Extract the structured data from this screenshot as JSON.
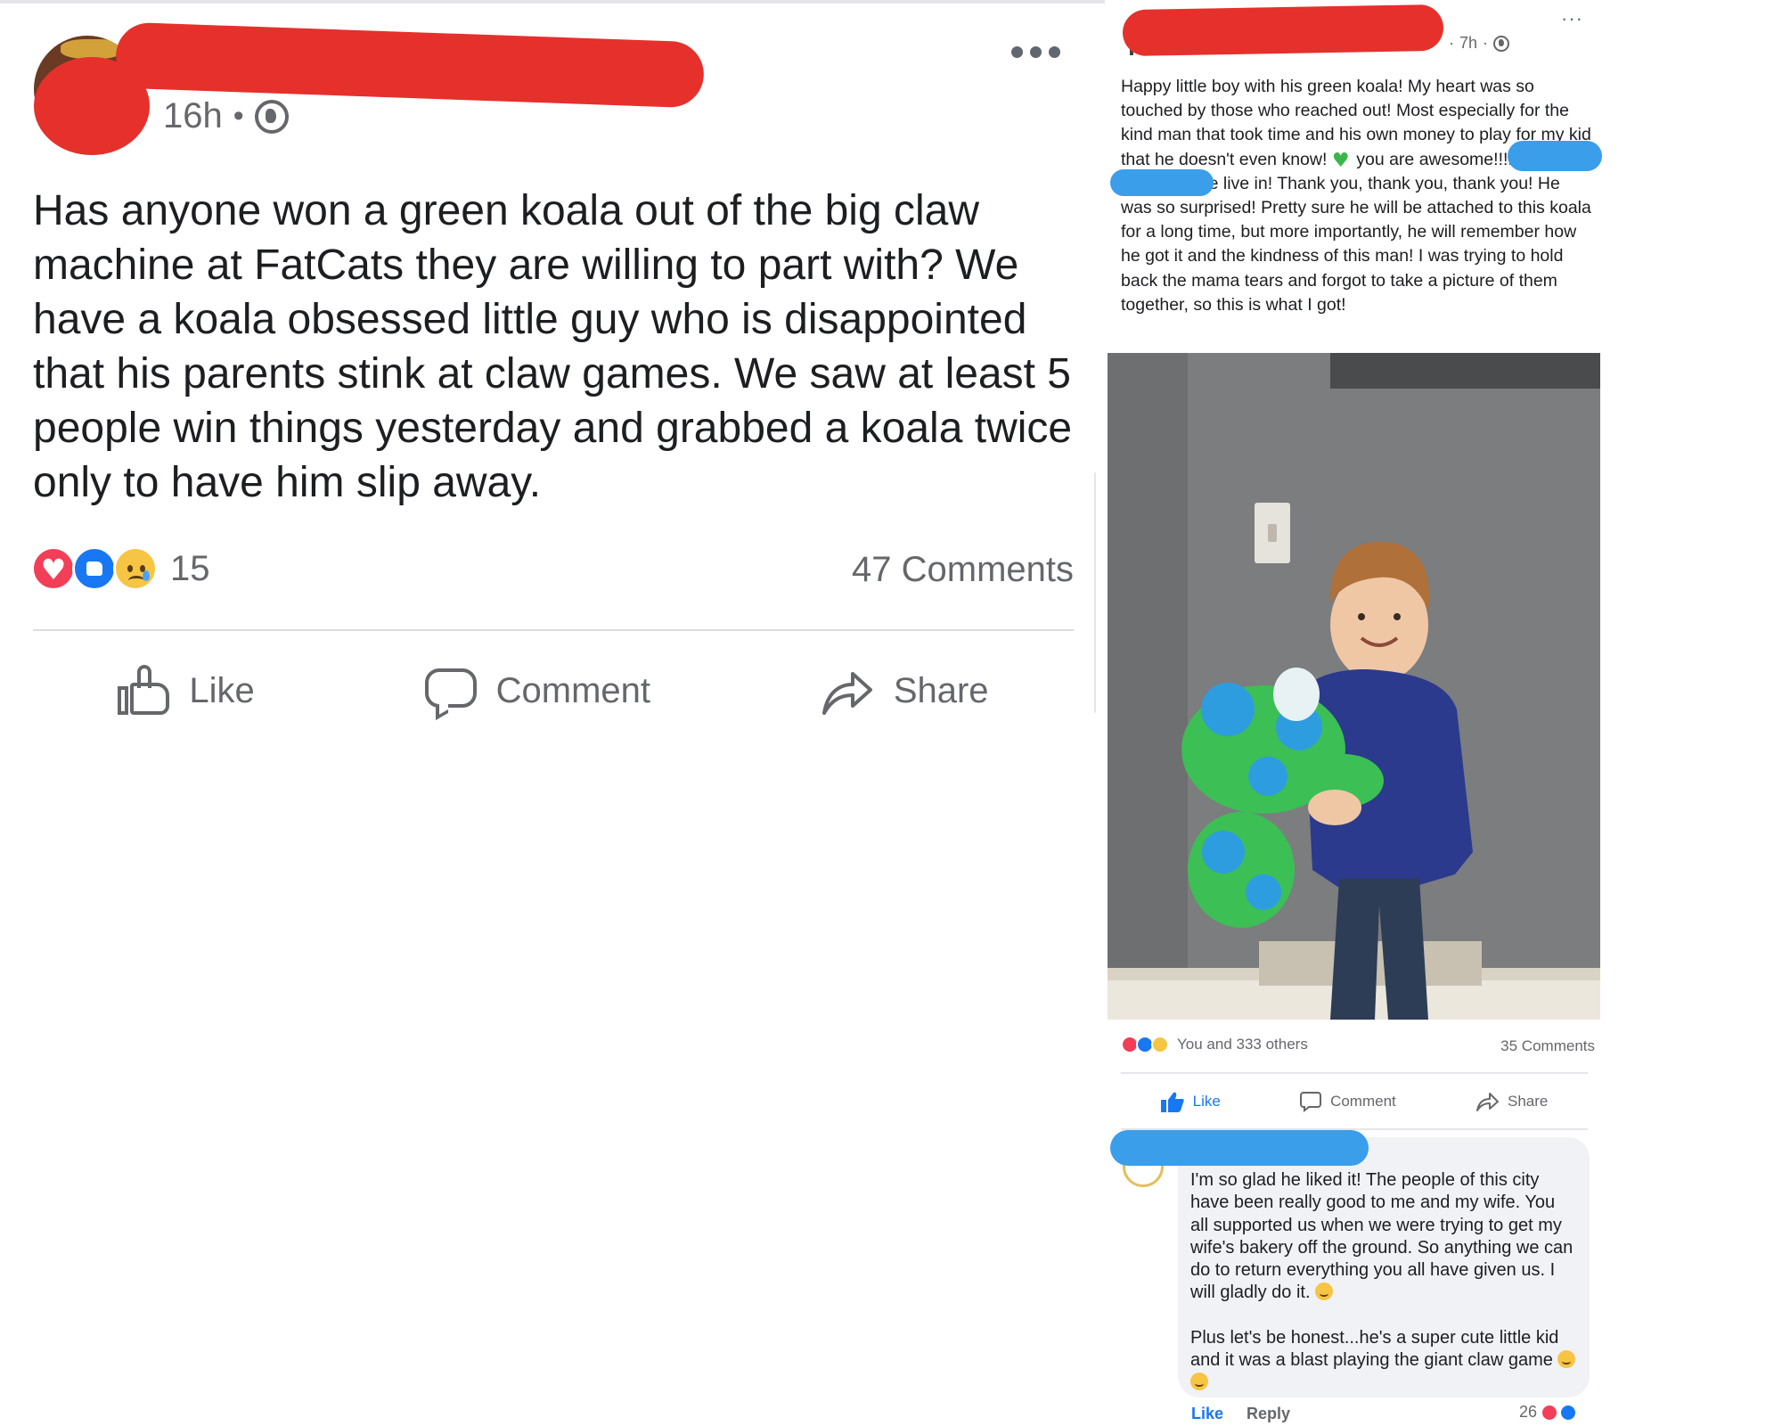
{
  "left_post": {
    "time": "16h",
    "separator": "•",
    "body": "Has anyone won a green koala out of the big claw machine at FatCats they are willing to part with? We have a koala obsessed little guy who is disappointed that his parents stink at claw games. We saw at least 5 people win things yesterday and grabbed a koala twice only to have him slip away.",
    "reaction_count": "15",
    "comments": "47 Comments",
    "actions": {
      "like": "Like",
      "comment": "Comment",
      "share": "Share"
    },
    "reactions": [
      "love-icon",
      "like-icon",
      "sad-icon"
    ]
  },
  "right_post": {
    "time": "7h",
    "separator": "·",
    "more": "···",
    "body_part1": "Happy little boy with his green koala! My heart was so touched by those who reached out! Most especially for the kind man that took time and his own money to play for my kid that he doesn't even know! ",
    "body_part2": " you are awesome!!!! What a great city we live in! Thank you, thank you, thank you! He was so surprised! Pretty sure he will be attached to this koala for a long time, but more importantly, he will remember how he got it and the kindness of this man! I was trying to hold back the mama tears and forgot to take a picture of them together, so this is what I got!",
    "reactions_text": "You and 333 others",
    "comments": "35 Comments",
    "actions": {
      "like": "Like",
      "comment": "Comment",
      "share": "Share"
    },
    "comment": {
      "para1": "I'm so glad he liked it! The people of this city have been really good to me and my wife. You all supported us when we were trying to get my wife's bakery off the ground. So anything we can do to return everything you all have given us. I will gladly do it. ",
      "para2": "Plus let's be honest...he's a super cute little kid and it was a blast playing the giant claw game ",
      "like": "Like",
      "reply": "Reply",
      "reaction_count": "26"
    }
  },
  "colors": {
    "facebook_blue": "#1877f2",
    "redaction_red": "#e5302c",
    "redaction_blue": "#3a9eea",
    "muted_text": "#65676b"
  }
}
